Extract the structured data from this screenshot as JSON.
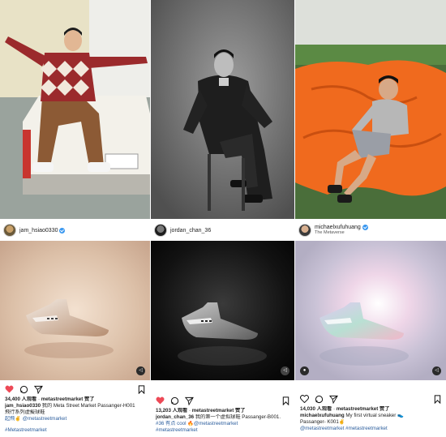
{
  "posts": [
    {
      "username": "jam_hsiao0330",
      "subtitle": "",
      "verified": true,
      "views": "34,400 人观看",
      "liked_by": "metastreetmarket 赞了",
      "caption_user": "jam_hsiao0330",
      "caption_line1": "我的 Meta Street Market Passanger-H001",
      "caption_line2": "飛行系列虛擬球鞋",
      "caption_line3": "起飛✌️ @metastreetmarket",
      "hashtag": "#Metastreetmarket",
      "liked": true,
      "has_mute_icon": true,
      "has_user_icon": false
    },
    {
      "username": "jordan_chan_36",
      "subtitle": "",
      "verified": false,
      "views": "13,203 人观看",
      "liked_by": "metastreetmarket 赞了",
      "caption_user": "jordan_chan_36",
      "caption_line1": "我的第一个虚拟球鞋 Passanger-B001.",
      "caption_line2": "#36 有点 cool 🔥@metastreetmarket",
      "caption_line3": "",
      "hashtag": "#metastreetmarket",
      "liked": true,
      "has_mute_icon": true,
      "has_user_icon": false
    },
    {
      "username": "michaelxufuhuang",
      "subtitle": "The Metaverse",
      "verified": true,
      "views": "14,030 人观看",
      "liked_by": "metastreetmarket 赞了",
      "caption_user": "michaelxufuhuang",
      "caption_line1": "My first virtual sneaker 👟",
      "caption_line2": "Passanger- K001✌️",
      "caption_line3": "@metastreetmarket #metastreetmarket",
      "hashtag": "",
      "liked": false,
      "has_mute_icon": true,
      "has_user_icon": true
    }
  ],
  "icons": {
    "heart": "heart-icon",
    "comment": "comment-icon",
    "share": "share-icon",
    "bookmark": "bookmark-icon",
    "mute": "mute-icon",
    "user": "user-icon",
    "verified": "verified-badge-icon"
  },
  "colors": {
    "like_red": "#ed4956",
    "link_blue": "#2d5f9e",
    "verified_blue": "#3897f0",
    "post1_bg": "#d9c1ae",
    "post2_bg": "#0e0e0e",
    "post3_bg": "#c9c2d6",
    "orange_blanket": "#f06a1e"
  }
}
